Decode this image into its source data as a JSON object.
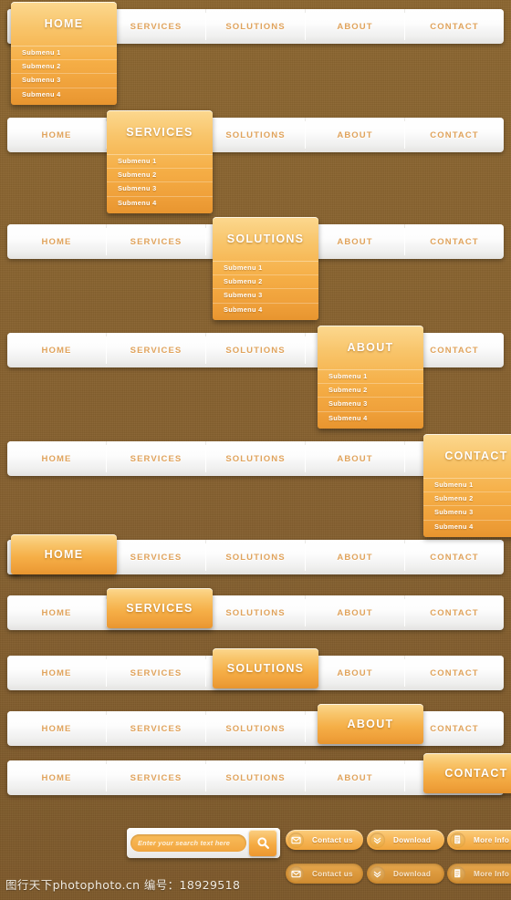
{
  "theme": {
    "background_color": "#8a6430",
    "accent_color": "#f2a63f",
    "bar_color": "#f5f4f2",
    "nav_text_color": "#e0a35c",
    "active_text_color": "#ffffff"
  },
  "nav": {
    "items": [
      "HOME",
      "SERVICES",
      "SOLUTIONS",
      "ABOUT",
      "CONTACT"
    ],
    "submenu": [
      "Submenu 1",
      "Submenu 2",
      "Submenu 3",
      "Submenu 4"
    ]
  },
  "bars": [
    {
      "active_index": 0,
      "has_submenu": true
    },
    {
      "active_index": 1,
      "has_submenu": true
    },
    {
      "active_index": 2,
      "has_submenu": true
    },
    {
      "active_index": 3,
      "has_submenu": true
    },
    {
      "active_index": 4,
      "has_submenu": true
    },
    {
      "active_index": 0,
      "has_submenu": false
    },
    {
      "active_index": 1,
      "has_submenu": false
    },
    {
      "active_index": 2,
      "has_submenu": false
    },
    {
      "active_index": 3,
      "has_submenu": false
    },
    {
      "active_index": 4,
      "has_submenu": false
    }
  ],
  "search": {
    "placeholder": "Enter your search text here",
    "value": "",
    "button_icon": "search-icon"
  },
  "buttons": {
    "row_normal": [
      {
        "label": "Contact us",
        "icon": "envelope-icon"
      },
      {
        "label": "Download",
        "icon": "double-chevron-down-icon"
      },
      {
        "label": "More Info",
        "icon": "document-icon"
      }
    ],
    "row_pressed": [
      {
        "label": "Contact us",
        "icon": "envelope-icon"
      },
      {
        "label": "Download",
        "icon": "double-chevron-down-icon"
      },
      {
        "label": "More Info",
        "icon": "document-icon"
      }
    ]
  },
  "watermark": {
    "text": "图行天下photophoto.cn  编号：18929518"
  }
}
